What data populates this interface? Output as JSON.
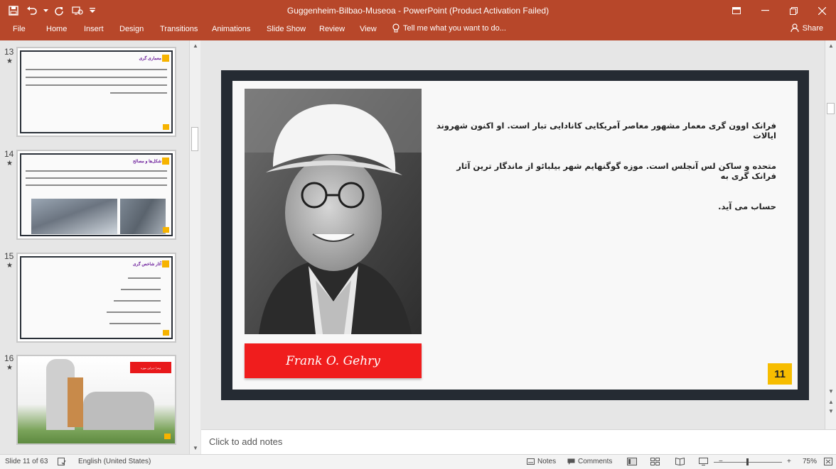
{
  "window": {
    "title": "Guggenheim-Bilbao-Museoa - PowerPoint (Product Activation Failed)"
  },
  "ribbon": {
    "tabs": [
      "File",
      "Home",
      "Insert",
      "Design",
      "Transitions",
      "Animations",
      "Slide Show",
      "Review",
      "View"
    ],
    "tell_me": "Tell me what you want to do...",
    "share": "Share"
  },
  "thumbnails": [
    {
      "number": "13",
      "star": "★",
      "title": "معماری گری",
      "badge": "13"
    },
    {
      "number": "14",
      "star": "★",
      "title": "شکل‌ها و مصالح",
      "badge": "14"
    },
    {
      "number": "15",
      "star": "★",
      "title": "آثار شاخص گری",
      "badge": "15"
    },
    {
      "number": "16",
      "star": "★",
      "title": "ویترا دیزاین موزه",
      "badge": "16"
    }
  ],
  "slide": {
    "name_label": "Frank O. Gehry",
    "paragraph_lines": [
      "فرانک اوون گری معمار مشهور معاصر آمریکایی کانادایی تبار است. او اکنون شهروند ایالات",
      "متحده و ساکن لس آنجلس است. موزه گوگنهایم شهر بیلبائو از ماندگار ترین آثار فرانک گری به",
      "حساب می آید."
    ],
    "page_number": "11"
  },
  "notes": {
    "placeholder": "Click to add notes"
  },
  "status": {
    "slide_info": "Slide 11 of 63",
    "language": "English (United States)",
    "notes": "Notes",
    "comments": "Comments",
    "zoom": "75%"
  },
  "colors": {
    "accent": "#b7472a",
    "slide_frame": "#252b33",
    "name_box": "#f01d1d",
    "page_badge": "#f7bd00"
  }
}
